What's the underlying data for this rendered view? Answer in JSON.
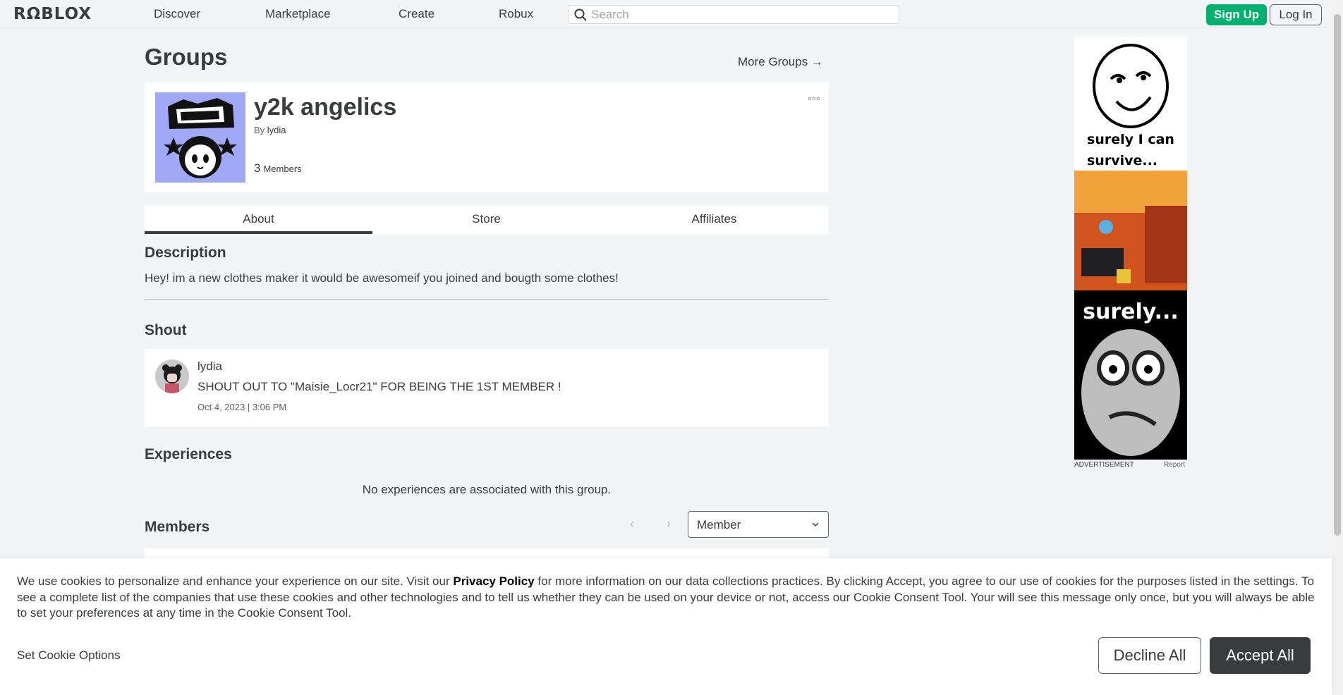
{
  "header": {
    "logo": "RΩBLOX",
    "nav": [
      "Discover",
      "Marketplace",
      "Create",
      "Robux"
    ],
    "search_placeholder": "Search",
    "signup_label": "Sign Up",
    "login_label": "Log In"
  },
  "page": {
    "title": "Groups",
    "more_groups": "More Groups →"
  },
  "group": {
    "name": "y2k angelics",
    "by_prefix": "By",
    "owner": "lydia",
    "member_count": "3",
    "members_label": "Members",
    "more_menu": "▫▫▫",
    "emblem_icon": "character-creator-emblem"
  },
  "tabs": [
    "About",
    "Store",
    "Affiliates"
  ],
  "about": {
    "description_heading": "Description",
    "description": "Hey! im a new clothes maker it would be awesomeif you joined and bougth some clothes!",
    "shout_heading": "Shout",
    "shout": {
      "poster": "lydia",
      "body": "SHOUT OUT TO \"Maisie_Locr21\" FOR BEING THE 1ST MEMBER !",
      "date": "Oct 4, 2023 | 3:06 PM"
    },
    "experiences_heading": "Experiences",
    "experiences_empty": "No experiences are associated with this group.",
    "members_heading": "Members",
    "pager_prev": "‹",
    "pager_next": "›",
    "role_selected": "Member"
  },
  "ad": {
    "label": "ADVERTISEMENT",
    "report": "Report",
    "text_top": "surely I can survive...",
    "text_bottom": "surely..."
  },
  "cookie": {
    "text_before": "We use cookies to personalize and enhance your experience on our site. Visit our ",
    "privacy_link": "Privacy Policy",
    "text_after": " for more information on our data collections practices. By clicking Accept, you agree to our use of cookies for the purposes listed in the settings. To see a complete list of the companies that use these cookies and other technologies and to tell us whether they can be used on your device or not, access our Cookie Consent Tool. Your will see this message only once, but you will always be able to set your preferences at any time in the Cookie Consent Tool.",
    "options_label": "Set Cookie Options",
    "decline_label": "Decline All",
    "accept_label": "Accept All"
  },
  "colors": {
    "signup_green": "#00b06f",
    "text_primary": "#393b3d",
    "page_bg": "#f2f4f5",
    "emblem_bg": "#9fa9f7"
  }
}
